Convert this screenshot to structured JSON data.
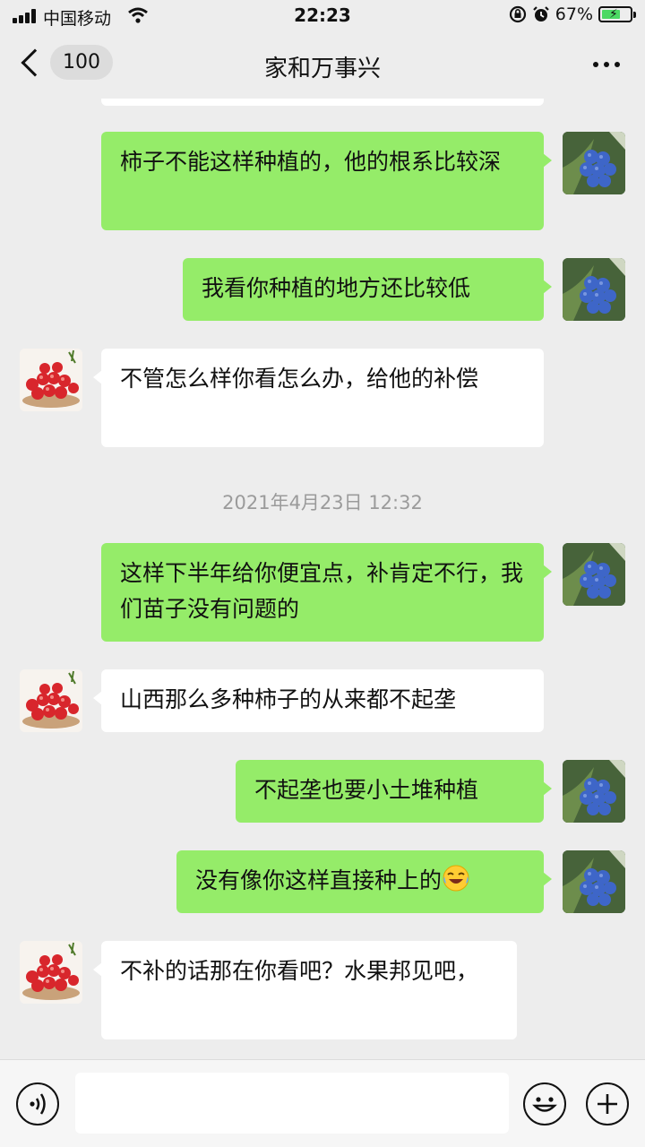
{
  "status_bar": {
    "carrier": "中国移动",
    "time": "22:23",
    "battery": "67%",
    "battery_level": 0.67
  },
  "header": {
    "unread_count": "100",
    "title": "家和万事兴"
  },
  "messages": [
    {
      "side": "sent",
      "text": "柿子不能这样种植的，他的根系比较深"
    },
    {
      "side": "sent",
      "text": "我看你种植的地方还比较低"
    },
    {
      "side": "received",
      "text": "不管怎么样你看怎么办，给他的补偿"
    },
    {
      "side": "sent",
      "text": "这样下半年给你便宜点，补肯定不行，我们苗子没有问题的"
    },
    {
      "side": "received",
      "text": "山西那么多种柿子的从来都不起垄"
    },
    {
      "side": "sent",
      "text": "不起垄也要小土堆种植"
    },
    {
      "side": "sent",
      "text": "没有像你这样直接种上的",
      "emoji": "laughing-crying-emoji"
    },
    {
      "side": "received",
      "text": "不补的话那在你看吧？水果邦见吧，"
    }
  ],
  "timestamp": "2021年4月23日 12:32",
  "input": {
    "value": "",
    "placeholder": ""
  },
  "icons": {
    "signal": "signal-icon",
    "wifi": "wifi-icon",
    "lock_rotation": "orientation-lock-icon",
    "alarm": "alarm-icon",
    "battery": "battery-icon",
    "back": "chevron-left-icon",
    "more": "more-dots-icon",
    "voice": "voice-icon",
    "emoji": "emoji-icon",
    "plus": "plus-icon",
    "avatar_self": "blueberry-avatar",
    "avatar_peer": "cherries-avatar"
  },
  "colors": {
    "background": "#ededed",
    "sent_bubble": "#95ec69",
    "received_bubble": "#ffffff",
    "timestamp": "#9b9b9b"
  }
}
